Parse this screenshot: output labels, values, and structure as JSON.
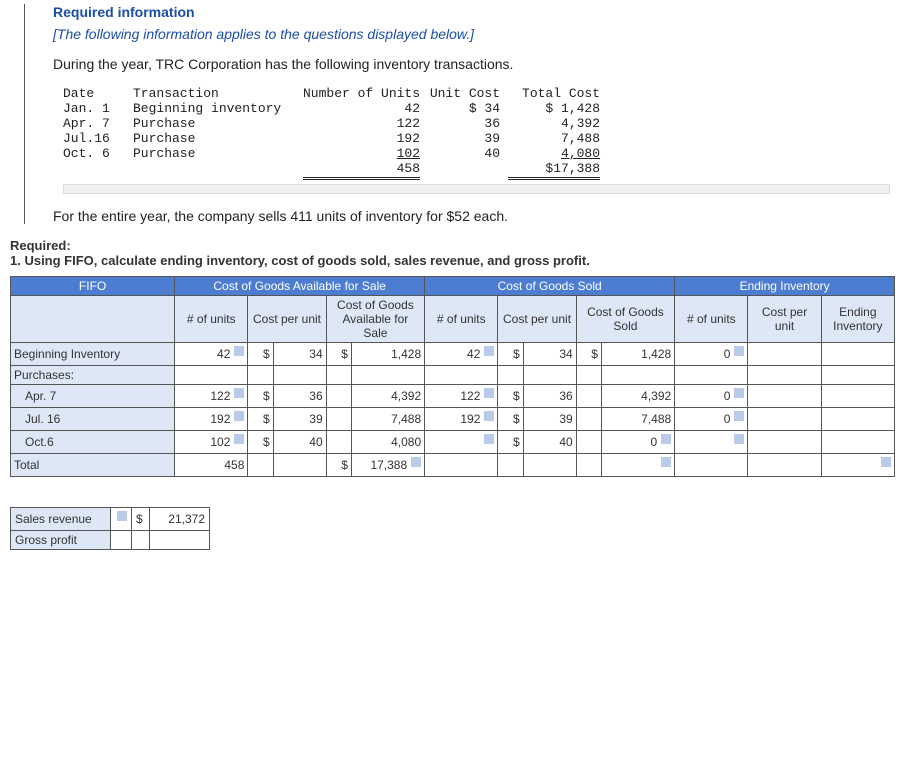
{
  "header": {
    "required_info": "Required information",
    "applies": "[The following information applies to the questions displayed below.]",
    "intro": "During the year, TRC Corporation has the following inventory transactions."
  },
  "inv_table": {
    "cols": {
      "date": "Date",
      "trans": "Transaction",
      "units": "Number of Units",
      "ucost": "Unit Cost",
      "tcost": "Total Cost"
    },
    "rows": [
      {
        "date": "Jan. 1",
        "trans": "Beginning inventory",
        "units": "42",
        "ucost": "$ 34",
        "tcost": "$ 1,428"
      },
      {
        "date": "Apr. 7",
        "trans": "Purchase",
        "units": "122",
        "ucost": "36",
        "tcost": "4,392"
      },
      {
        "date": "Jul.16",
        "trans": "Purchase",
        "units": "192",
        "ucost": "39",
        "tcost": "7,488"
      },
      {
        "date": "Oct. 6",
        "trans": "Purchase",
        "units": "102",
        "ucost": "40",
        "tcost": "4,080"
      }
    ],
    "totals": {
      "units": "458",
      "tcost": "$17,388"
    }
  },
  "mid_text": "For the entire year, the company sells 411 units of inventory for $52 each.",
  "required": {
    "label": "Required:",
    "q1": "1. Using FIFO, calculate ending inventory, cost of goods sold, sales revenue, and gross profit."
  },
  "fifo": {
    "title": "FIFO",
    "group_headers": {
      "cogas": "Cost of Goods Available for Sale",
      "cogs": "Cost of Goods Sold",
      "ei": "Ending Inventory"
    },
    "sub_headers": {
      "units": "# of units",
      "cpu": "Cost per unit",
      "cogas_cost": "Cost of Goods Available for Sale",
      "cogs_cost": "Cost of Goods Sold",
      "ei_cpu": "Cost per unit",
      "ei_total": "Ending Inventory"
    },
    "row_labels": {
      "begin": "Beginning Inventory",
      "purchases": "Purchases:",
      "apr7": "Apr. 7",
      "jul16": "Jul. 16",
      "oct6": "Oct.6",
      "total": "Total"
    },
    "rows": {
      "begin": {
        "a_units": "42",
        "a_ds": "$",
        "a_cpu": "34",
        "a_cds": "$",
        "a_cost": "1,428",
        "s_units": "42",
        "s_ds": "$",
        "s_cpu": "34",
        "s_cds": "$",
        "s_cost": "1,428",
        "e_units": "0"
      },
      "apr7": {
        "a_units": "122",
        "a_ds": "$",
        "a_cpu": "36",
        "a_cost": "4,392",
        "s_units": "122",
        "s_ds": "$",
        "s_cpu": "36",
        "s_cost": "4,392",
        "e_units": "0"
      },
      "jul16": {
        "a_units": "192",
        "a_ds": "$",
        "a_cpu": "39",
        "a_cost": "7,488",
        "s_units": "192",
        "s_ds": "$",
        "s_cpu": "39",
        "s_cost": "7,488",
        "e_units": "0"
      },
      "oct6": {
        "a_units": "102",
        "a_ds": "$",
        "a_cpu": "40",
        "a_cost": "4,080",
        "s_ds": "$",
        "s_cpu": "40",
        "s_cost": "0"
      },
      "total": {
        "a_units": "458",
        "a_cds": "$",
        "a_cost": "17,388"
      }
    }
  },
  "summary": {
    "sales_label": "Sales revenue",
    "sales_ds": "$",
    "sales_val": "21,372",
    "gp_label": "Gross profit"
  }
}
